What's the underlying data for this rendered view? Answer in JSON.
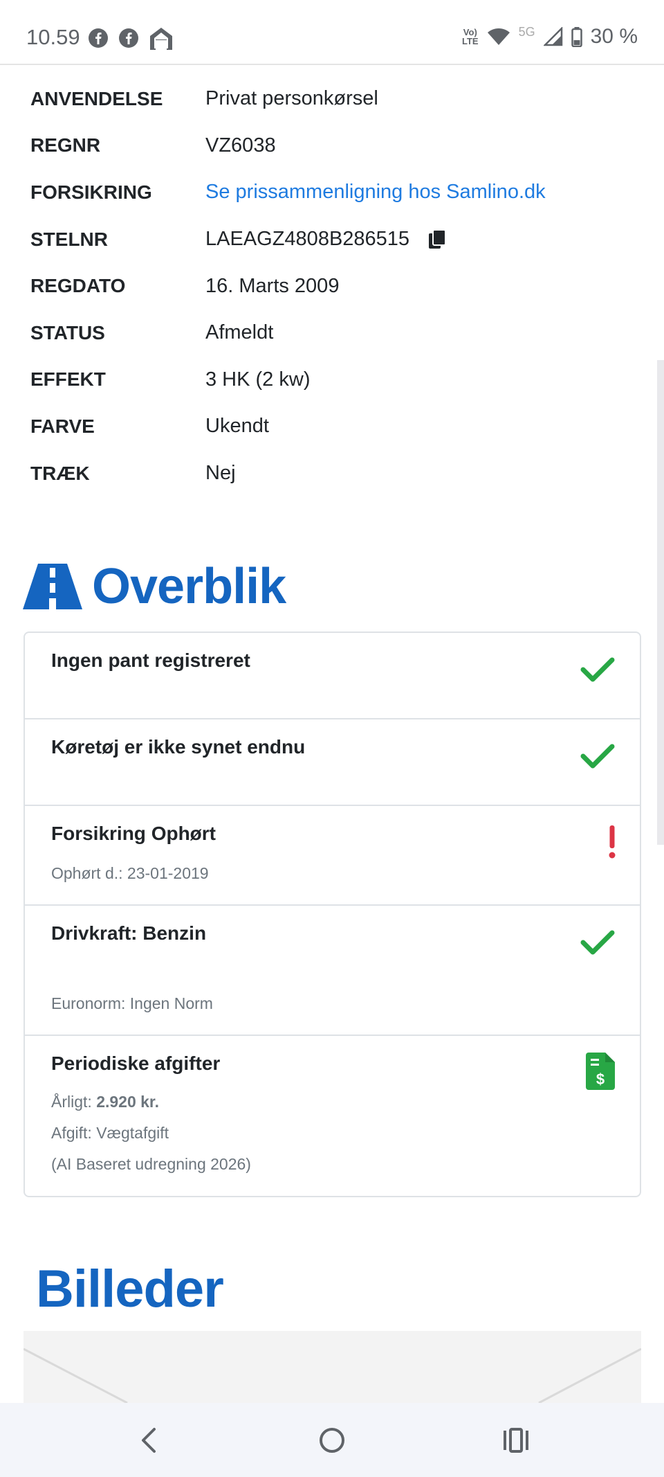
{
  "status_bar": {
    "time": "10.59",
    "left_icons": [
      "facebook-icon",
      "facebook-icon",
      "home-icon"
    ],
    "network_lte": "Vo LTE",
    "network_5g": "5G",
    "battery": "30 %"
  },
  "specs": [
    {
      "label": "ANVENDELSE",
      "value": "Privat personkørsel"
    },
    {
      "label": "REGNR",
      "value": "VZ6038"
    },
    {
      "label": "FORSIKRING",
      "value": "Se prissammenligning hos Samlino.dk",
      "link": true
    },
    {
      "label": "STELNR",
      "value": "LAEAGZ4808B286515",
      "copy": true
    },
    {
      "label": "REGDATO",
      "value": "16. Marts 2009"
    },
    {
      "label": "STATUS",
      "value": "Afmeldt"
    },
    {
      "label": "EFFEKT",
      "value": "3 HK (2 kw)"
    },
    {
      "label": "FARVE",
      "value": "Ukendt"
    },
    {
      "label": "TRÆK",
      "value": "Nej"
    }
  ],
  "overview": {
    "heading": "Overblik",
    "heading_icon": "road-icon",
    "items": [
      {
        "title": "Ingen pant registreret",
        "status": "ok"
      },
      {
        "title": "Køretøj er ikke synet endnu",
        "status": "ok"
      },
      {
        "title": "Forsikring Ophørt",
        "status": "warning",
        "sub": "Ophørt d.: 23-01-2019"
      },
      {
        "title": "Drivkraft: Benzin",
        "status": "ok",
        "sub": "Euronorm: Ingen Norm"
      },
      {
        "title": "Periodiske afgifter",
        "status": "invoice",
        "yearly_label": "Årligt:",
        "yearly_value": "2.920 kr.",
        "fee": "Afgift: Vægtafgift",
        "note": "(AI Baseret udregning 2026)"
      }
    ]
  },
  "images_section": {
    "heading": "Billeder"
  },
  "colors": {
    "brand_blue": "#1565c0",
    "link_blue": "#1e7be0",
    "ok_green": "#28a745",
    "warning_red": "#dc3545"
  },
  "nav": [
    "back-icon",
    "home-circle-icon",
    "recents-icon"
  ]
}
